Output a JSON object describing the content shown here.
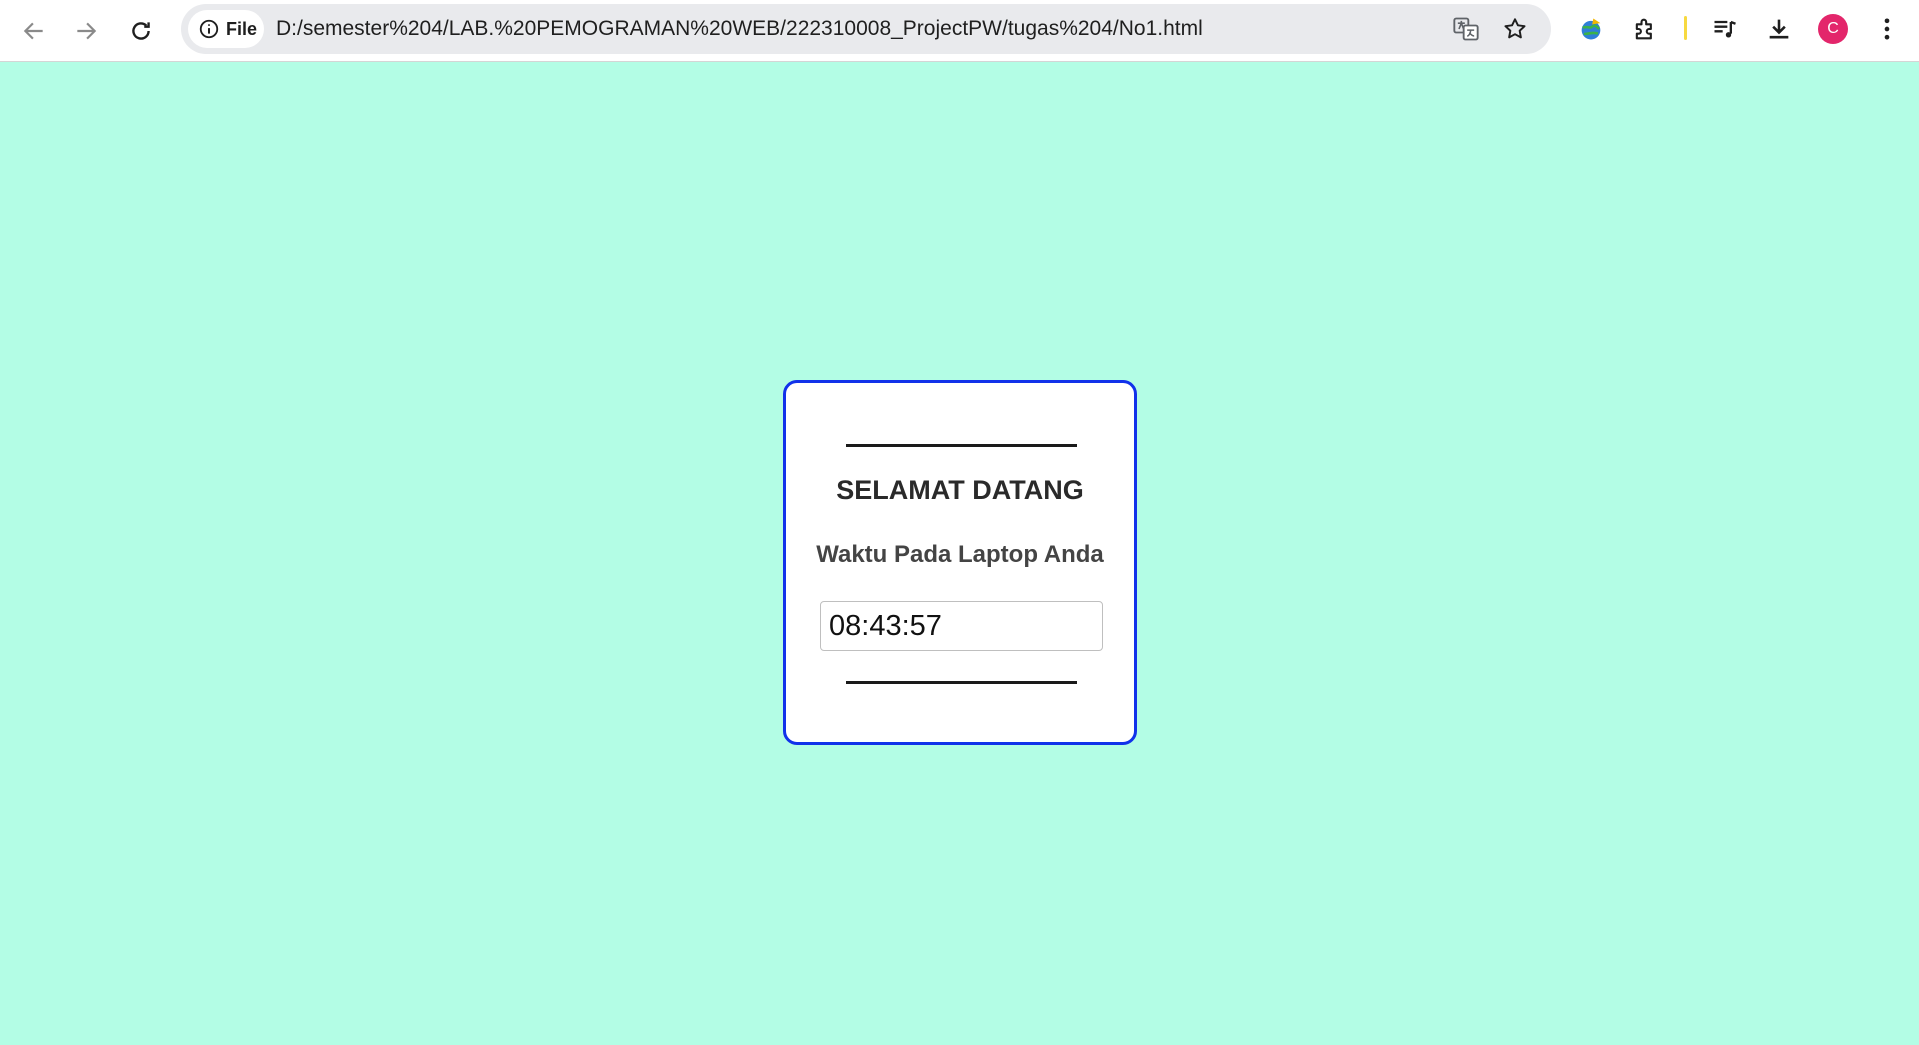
{
  "browser": {
    "site_chip_label": "File",
    "url": "D:/semester%204/LAB.%20PEMOGRAMAN%20WEB/222310008_ProjectPW/tugas%204/No1.html",
    "profile_initial": "C",
    "accent_profile": "#e3266b"
  },
  "page": {
    "background": "#b3fde5",
    "card_border_color": "#1132ea",
    "title": "SELAMAT DATANG",
    "subtitle": "Waktu Pada Laptop Anda",
    "clock_value": "08:43:57"
  }
}
